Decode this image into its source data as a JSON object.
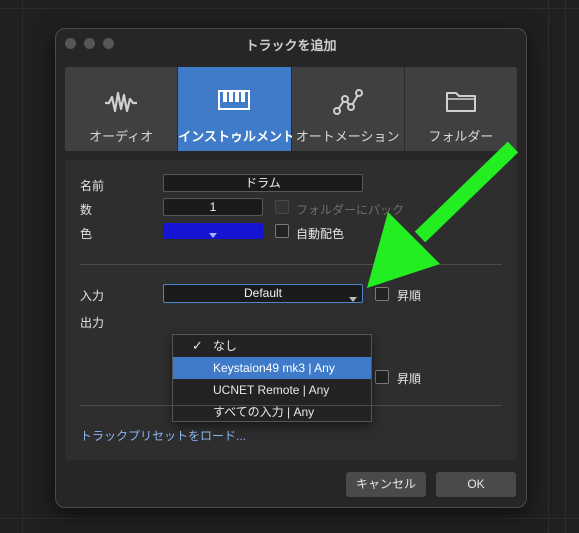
{
  "dialog": {
    "title": "トラックを追加"
  },
  "tabs": [
    {
      "label": "オーディオ",
      "icon": "waveform-icon",
      "active": false
    },
    {
      "label": "インストゥルメント",
      "icon": "piano-keys-icon",
      "active": true
    },
    {
      "label": "オートメーション",
      "icon": "automation-curve-icon",
      "active": false
    },
    {
      "label": "フォルダー",
      "icon": "folder-icon",
      "active": false
    }
  ],
  "form": {
    "name_label": "名前",
    "name_value": "ドラム",
    "count_label": "数",
    "count_value": "1",
    "color_label": "色",
    "color_value": "#1414d2",
    "folder_checkbox_label": "フォルダーにパック",
    "auto_color_label": "自動配色",
    "input_label": "入力",
    "input_selected": "Default",
    "ascending_label": "昇順",
    "output_label": "出力",
    "ascending_label_2": "昇順"
  },
  "dropdown": {
    "items": [
      {
        "label": "なし",
        "checked": true,
        "highlighted": false
      },
      {
        "label": "Keystaion49 mk3 | Any",
        "checked": false,
        "highlighted": true
      },
      {
        "label": "UCNET Remote | Any",
        "checked": false,
        "highlighted": false
      },
      {
        "label": "すべての入力 | Any",
        "checked": false,
        "highlighted": false
      }
    ]
  },
  "preset_link": "トラックプリセットをロード...",
  "buttons": {
    "cancel": "キャンセル",
    "ok": "OK"
  },
  "colors": {
    "accent": "#3f7bc9",
    "annotation_arrow": "#22ee22"
  }
}
